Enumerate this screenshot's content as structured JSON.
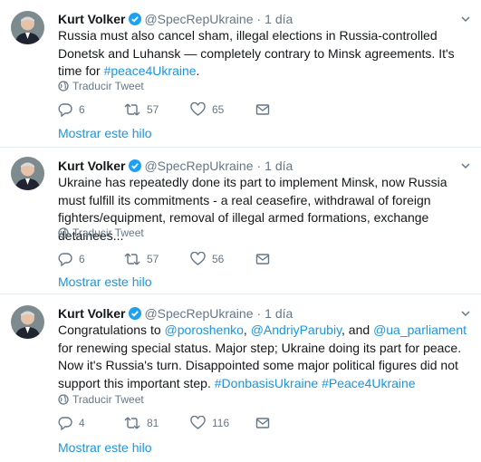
{
  "colors": {
    "link": "#1b95e0",
    "meta": "#657786",
    "verified": "#1da1f2",
    "divider": "#e6ecf0"
  },
  "tweets": [
    {
      "author_name": "Kurt Volker",
      "handle": "@SpecRepUkraine",
      "separator": "·",
      "time": "1 día",
      "text_parts": [
        "Russia must also cancel sham, illegal elections in Russia-controlled Donetsk and Luhansk — completely contrary to Minsk agreements.  It's time for ",
        "#peace4Ukraine",
        "."
      ],
      "translate_label": "Traducir Tweet",
      "replies": "6",
      "retweets": "57",
      "likes": "65",
      "thread_link": "Mostrar este hilo"
    },
    {
      "author_name": "Kurt Volker",
      "handle": "@SpecRepUkraine",
      "separator": "·",
      "time": "1 día",
      "text_parts": [
        "Ukraine has repeatedly done its part to implement Minsk, now Russia must fulfill its commitments - a real ceasefire, withdrawal of foreign fighters/equipment, removal of illegal armed formations, exchange detainees..."
      ],
      "translate_label": "Traducir Tweet",
      "replies": "6",
      "retweets": "57",
      "likes": "56",
      "thread_link": "Mostrar este hilo"
    },
    {
      "author_name": "Kurt Volker",
      "handle": "@SpecRepUkraine",
      "separator": "·",
      "time": "1 día",
      "text_parts": [
        "Congratulations to ",
        "@poroshenko",
        ", ",
        "@AndriyParubiy",
        ", and ",
        "@ua_parliament",
        " for renewing special status.  Major step; Ukraine doing its part for peace.  Now it's Russia's turn.  Disappointed some major political figures did not support this important step. ",
        "#DonbasisUkraine",
        " ",
        "#Peace4Ukraine"
      ],
      "translate_label": "Traducir Tweet",
      "replies": "4",
      "retweets": "81",
      "likes": "116",
      "thread_link": "Mostrar este hilo"
    }
  ]
}
